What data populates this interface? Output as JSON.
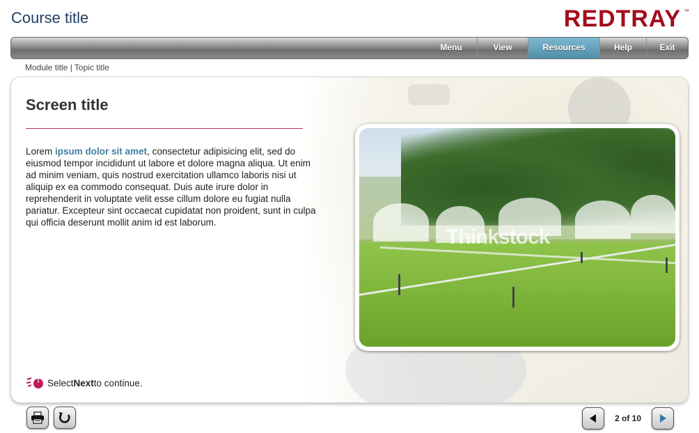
{
  "header": {
    "course_title": "Course title",
    "logo_text": "REDTRAY",
    "logo_tm": "™",
    "brand_color": "#a30d1d"
  },
  "nav": {
    "items": [
      {
        "label": "Menu",
        "active": false
      },
      {
        "label": "View",
        "active": false
      },
      {
        "label": "Resources",
        "active": true
      },
      {
        "label": "Help",
        "active": false
      },
      {
        "label": "Exit",
        "active": false
      }
    ],
    "active_color": "#5b9bb6"
  },
  "breadcrumb": "Module title | Topic title",
  "content": {
    "screen_title": "Screen title",
    "body_pre": "Lorem ",
    "body_highlight": "ipsum dolor sit amet",
    "body_post": ", consectetur adipisicing elit, sed do eiusmod tempor incididunt ut labore et dolore magna aliqua. Ut enim ad minim veniam, quis nostrud exercitation ullamco laboris nisi ut aliquip ex ea commodo consequat. Duis aute irure dolor in reprehenderit in voluptate velit esse cillum dolore eu fugiat nulla pariatur. Excepteur sint occaecat cupidatat non proident, sunt in culpa qui officia deserunt mollit anim id est laborum.",
    "image_watermark": "Thinkstock",
    "accent_rule_color": "#b0306a"
  },
  "hint": {
    "pre": "Select ",
    "bold": "Next",
    "post": " to continue."
  },
  "footer": {
    "icons": [
      "printer-icon",
      "replay-icon",
      "back-arrow-icon",
      "next-arrow-icon"
    ],
    "page_counter": "2 of 10"
  }
}
